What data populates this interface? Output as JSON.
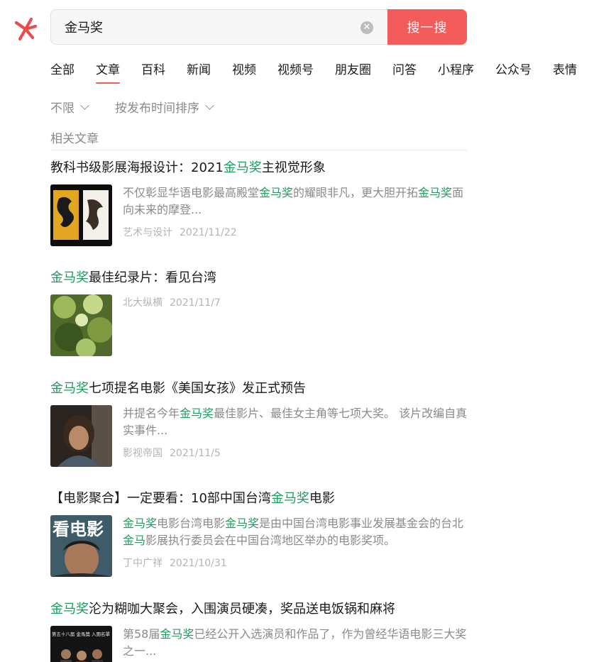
{
  "search": {
    "query": "金马奖",
    "button_label": "搜一搜"
  },
  "tabs": [
    "全部",
    "文章",
    "百科",
    "新闻",
    "视频",
    "视频号",
    "朋友圈",
    "问答",
    "小程序",
    "公众号",
    "表情"
  ],
  "active_tab": "文章",
  "filters": [
    "不限",
    "按发布时间排序"
  ],
  "section_label": "相关文章",
  "highlight_color": "#1e9b60",
  "accent_color": "#f25c5a",
  "articles": [
    {
      "title_pre": "教科书级影展海报设计：2021",
      "title_hl": "金马奖",
      "title_post": "主视觉形象",
      "snippet_parts": [
        "不仅彰显华语电影最高殿堂",
        "金马奖",
        "的耀眼非凡，更大胆开拓",
        "金马奖",
        "面向未来的摩登..."
      ],
      "source": "艺术与设计",
      "date": "2021/11/22"
    },
    {
      "title_pre": "",
      "title_hl": "金马奖",
      "title_post": "最佳纪录片：看见台湾",
      "snippet_parts": [],
      "source": "北大纵横",
      "date": "2021/11/7"
    },
    {
      "title_pre": "",
      "title_hl": "金马奖",
      "title_post": "七项提名电影《美国女孩》发正式预告",
      "snippet_parts": [
        "并提名今年",
        "金马奖",
        "最佳影片、最佳女主角等七项大奖。 该片改编自真实事件..."
      ],
      "source": "影视帝国",
      "date": "2021/11/5"
    },
    {
      "title_pre": "【电影聚合】一定要看：10部中国台湾",
      "title_hl": "金马奖",
      "title_post": "电影",
      "snippet_parts": [
        "金马奖",
        "电影台湾电影",
        "金马奖",
        "是由中国台湾电影事业发展基金会的台北",
        "金马",
        "影展执行委员会在中国台湾地区举办的电影奖项。"
      ],
      "source": "丁中广祥",
      "date": "2021/10/31"
    },
    {
      "title_pre": "",
      "title_hl": "金马奖",
      "title_post": "沦为糊咖大聚会，入围演员硬凑，奖品送电饭锅和麻将",
      "snippet_parts": [
        "第58届",
        "金马奖",
        "已经公开入选演员和作品了，作为曾经华语电影三大奖之一..."
      ],
      "source": "",
      "date": ""
    }
  ],
  "thumb_texts": {
    "article4": "看电影",
    "article5": "第五十八届 金馬獎 入圍名單"
  },
  "icons": {
    "logo": "wechat-search-logo-icon",
    "clear": "clear-icon",
    "filter": "chevron-down-icon"
  }
}
